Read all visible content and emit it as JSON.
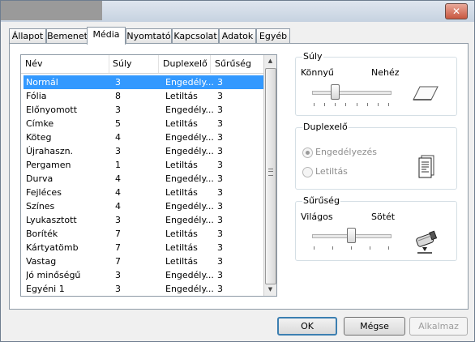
{
  "titlebar": {
    "close_glyph": "✕"
  },
  "tabs": [
    {
      "label": "Állapot"
    },
    {
      "label": "Bemenet"
    },
    {
      "label": "Média"
    },
    {
      "label": "Nyomtató"
    },
    {
      "label": "Kapcsolat"
    },
    {
      "label": "Adatok"
    },
    {
      "label": "Egyéb"
    }
  ],
  "active_tab": "Média",
  "media_list": {
    "headers": [
      "Név",
      "Súly",
      "Duplexelő",
      "Sűrűség"
    ],
    "selected_index": 0,
    "rows": [
      [
        "Normál",
        "3",
        "Engedély...",
        "3"
      ],
      [
        "Fólia",
        "8",
        "Letiltás",
        "3"
      ],
      [
        "Előnyomott",
        "3",
        "Engedély...",
        "3"
      ],
      [
        "Címke",
        "5",
        "Letiltás",
        "3"
      ],
      [
        "Köteg",
        "4",
        "Engedély...",
        "3"
      ],
      [
        "Újrahaszn.",
        "3",
        "Engedély...",
        "3"
      ],
      [
        "Pergamen",
        "1",
        "Letiltás",
        "3"
      ],
      [
        "Durva",
        "4",
        "Engedély...",
        "3"
      ],
      [
        "Fejléces",
        "4",
        "Letiltás",
        "3"
      ],
      [
        "Színes",
        "4",
        "Engedély...",
        "3"
      ],
      [
        "Lyukasztott",
        "3",
        "Engedély...",
        "3"
      ],
      [
        "Boríték",
        "7",
        "Letiltás",
        "3"
      ],
      [
        "Kártyatömb",
        "7",
        "Letiltás",
        "3"
      ],
      [
        "Vastag",
        "7",
        "Letiltás",
        "3"
      ],
      [
        "Jó minőségű",
        "3",
        "Engedély...",
        "3"
      ],
      [
        "Egyéni 1",
        "3",
        "Engedély...",
        "3"
      ]
    ]
  },
  "weight_group": {
    "title": "Súly",
    "left_label": "Könnyű",
    "right_label": "Nehéz",
    "value": 3,
    "range": [
      1,
      8
    ],
    "icon": "paper-sheet-icon"
  },
  "duplex_group": {
    "title": "Duplexelő",
    "options": [
      "Engedélyezés",
      "Letiltás"
    ],
    "selected": "Engedélyezés",
    "icon": "duplex-document-icon"
  },
  "density_group": {
    "title": "Sűrűség",
    "left_label": "Világos",
    "right_label": "Sötét",
    "value": 3,
    "range": [
      1,
      5
    ],
    "icon": "toner-cartridge-icon"
  },
  "buttons": {
    "ok": "OK",
    "cancel": "Mégse",
    "apply": "Alkalmaz"
  }
}
